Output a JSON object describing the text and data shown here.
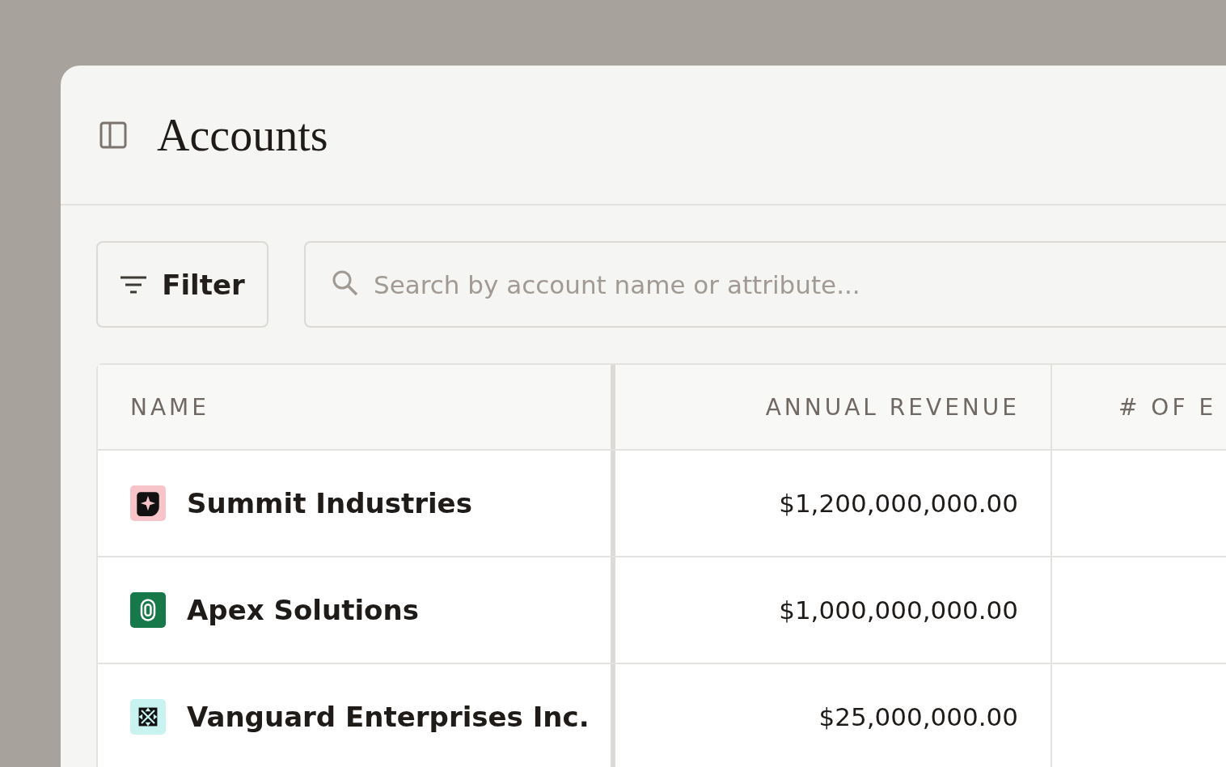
{
  "page": {
    "title": "Accounts"
  },
  "toolbar": {
    "filter_label": "Filter",
    "search": {
      "placeholder": "Search by account name or attribute..."
    }
  },
  "table": {
    "columns": [
      "NAME",
      "ANNUAL REVENUE",
      "# OF E"
    ],
    "rows": [
      {
        "name": "Summit Industries",
        "logo": {
          "kind": "spark",
          "color": "#f7c5c9"
        },
        "annual_revenue": "$1,200,000,000.00"
      },
      {
        "name": "Apex Solutions",
        "logo": {
          "kind": "ring",
          "color": "#17784a"
        },
        "annual_revenue": "$1,000,000,000.00"
      },
      {
        "name": "Vanguard Enterprises Inc.",
        "logo": {
          "kind": "arrows",
          "color": "#c9f3f0"
        },
        "annual_revenue": "$25,000,000.00"
      }
    ]
  }
}
